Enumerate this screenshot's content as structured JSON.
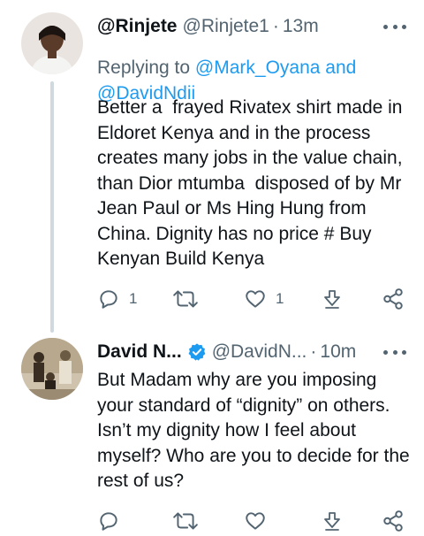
{
  "tweet1": {
    "name": "@Rinjete",
    "handle": "@Rinjete1",
    "separator": "·",
    "time": "13m",
    "replying_prefix": "Replying to",
    "replying_targets": "@Mark_Oyana and @DavidNdii",
    "text": "Better a  frayed Rivatex shirt made in Eldoret Kenya and in the process creates many jobs in the value chain, than Dior mtumba  disposed of by Mr Jean Paul or Ms Hing Hung from China. Dignity has no price # Buy Kenyan Build Kenya",
    "replies": "1",
    "likes": "1"
  },
  "tweet2": {
    "name": "David N...",
    "handle": "@DavidN...",
    "separator": "·",
    "time": "10m",
    "verified": true,
    "text": "But Madam why are you imposing your standard of “dignity” on others. Isn’t my dignity how I feel about myself? Who are you to decide for the rest of us?"
  },
  "colors": {
    "link": "#1d9bf0",
    "secondary_text": "#536471",
    "thread_line": "#cfd9de"
  },
  "icons": [
    "reply-icon",
    "retweet-icon",
    "like-icon",
    "download-icon",
    "share-icon",
    "more-icon",
    "verified-badge-icon"
  ]
}
